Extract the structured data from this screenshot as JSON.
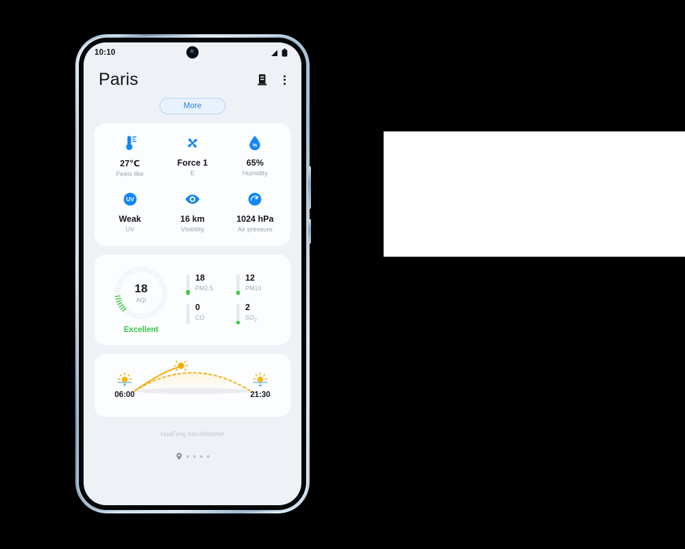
{
  "status_bar": {
    "clock": "10:10",
    "icons": [
      "signal-icon",
      "battery-icon"
    ]
  },
  "app_bar": {
    "title": "Paris",
    "icons": [
      "city-list-icon",
      "overflow-menu-icon"
    ]
  },
  "more_button": {
    "label": "More"
  },
  "details_card": {
    "items": [
      {
        "icon": "thermometer-icon",
        "value": "27℃",
        "label": "Feels like"
      },
      {
        "icon": "wind-fan-icon",
        "value": "Force 1",
        "label": "E"
      },
      {
        "icon": "humidity-drop-icon",
        "value": "65%",
        "label": "Humidity"
      },
      {
        "icon": "uv-index-icon",
        "value": "Weak",
        "label": "UV"
      },
      {
        "icon": "eye-visibility-icon",
        "value": "16 km",
        "label": "Visibility"
      },
      {
        "icon": "barometer-icon",
        "value": "1024 hPa",
        "label": "Air pressure"
      }
    ]
  },
  "air_quality_card": {
    "aqi_value": "18",
    "aqi_caption": "AQI",
    "aqi_level": "Excellent",
    "aqi_color": "#35c442",
    "gauge_percent": 12,
    "pollutants": [
      {
        "value": "18",
        "label": "PM2.5",
        "sub": "",
        "fill_percent": 22
      },
      {
        "value": "12",
        "label": "PM10",
        "sub": "",
        "fill_percent": 20
      },
      {
        "value": "0",
        "label": "CO",
        "sub": "",
        "fill_percent": 0
      },
      {
        "value": "2",
        "label": "SO",
        "sub": "2",
        "fill_percent": 16
      }
    ]
  },
  "sun_card": {
    "sunrise_icon": "sunrise-icon",
    "sunrise_time": "06:00",
    "sunset_icon": "sunset-icon",
    "sunset_time": "21:30",
    "sun_progress_percent": 40,
    "arc_color": "#f5a906"
  },
  "footer": {
    "source": "HuaFeng AccuWeather",
    "pager": {
      "location_icon": "location-pin-icon",
      "dots": 4
    }
  }
}
